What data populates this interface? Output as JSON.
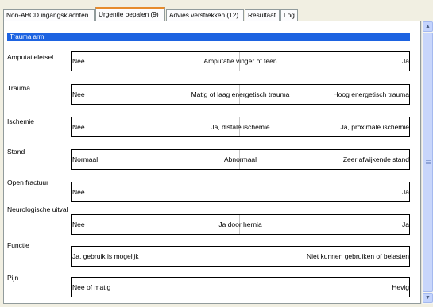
{
  "tabs": [
    {
      "label": "Non-ABCD ingangsklachten"
    },
    {
      "label": "Urgentie bepalen (9)"
    },
    {
      "label": "Advies verstrekken (12)"
    },
    {
      "label": "Resultaat"
    },
    {
      "label": "Log"
    }
  ],
  "active_tab_index": 1,
  "section": {
    "title": "Trauma arm"
  },
  "rows": [
    {
      "label": "Amputatieletsel",
      "left": "Nee",
      "middle": "Amputatie vinger of teen",
      "right": "Ja"
    },
    {
      "label": "Trauma",
      "left": "Nee",
      "middle": "Matig of laag energetisch trauma",
      "right": "Hoog energetisch trauma"
    },
    {
      "label": "Ischemie",
      "left": "Nee",
      "middle": "Ja, distale ischemie",
      "right": "Ja, proximale ischemie"
    },
    {
      "label": "Stand",
      "left": "Normaal",
      "middle": "Abnormaal",
      "right": "Zeer afwijkende stand"
    },
    {
      "label": "Open fractuur",
      "left": "Nee",
      "middle": "",
      "right": "Ja"
    },
    {
      "label": "Neurologische uitval",
      "left": "Nee",
      "middle": "Ja door hernia",
      "right": "Ja"
    },
    {
      "label": "Functie",
      "left": "Ja, gebruik is mogelijk",
      "middle": "",
      "right": "Niet kunnen gebruiken of belasten"
    },
    {
      "label": "Pijn",
      "left": "Nee of matig",
      "middle": "",
      "right": "Hevig"
    }
  ],
  "scroll_icons": {
    "up": "chevron-up-icon",
    "down": "chevron-down-icon"
  }
}
